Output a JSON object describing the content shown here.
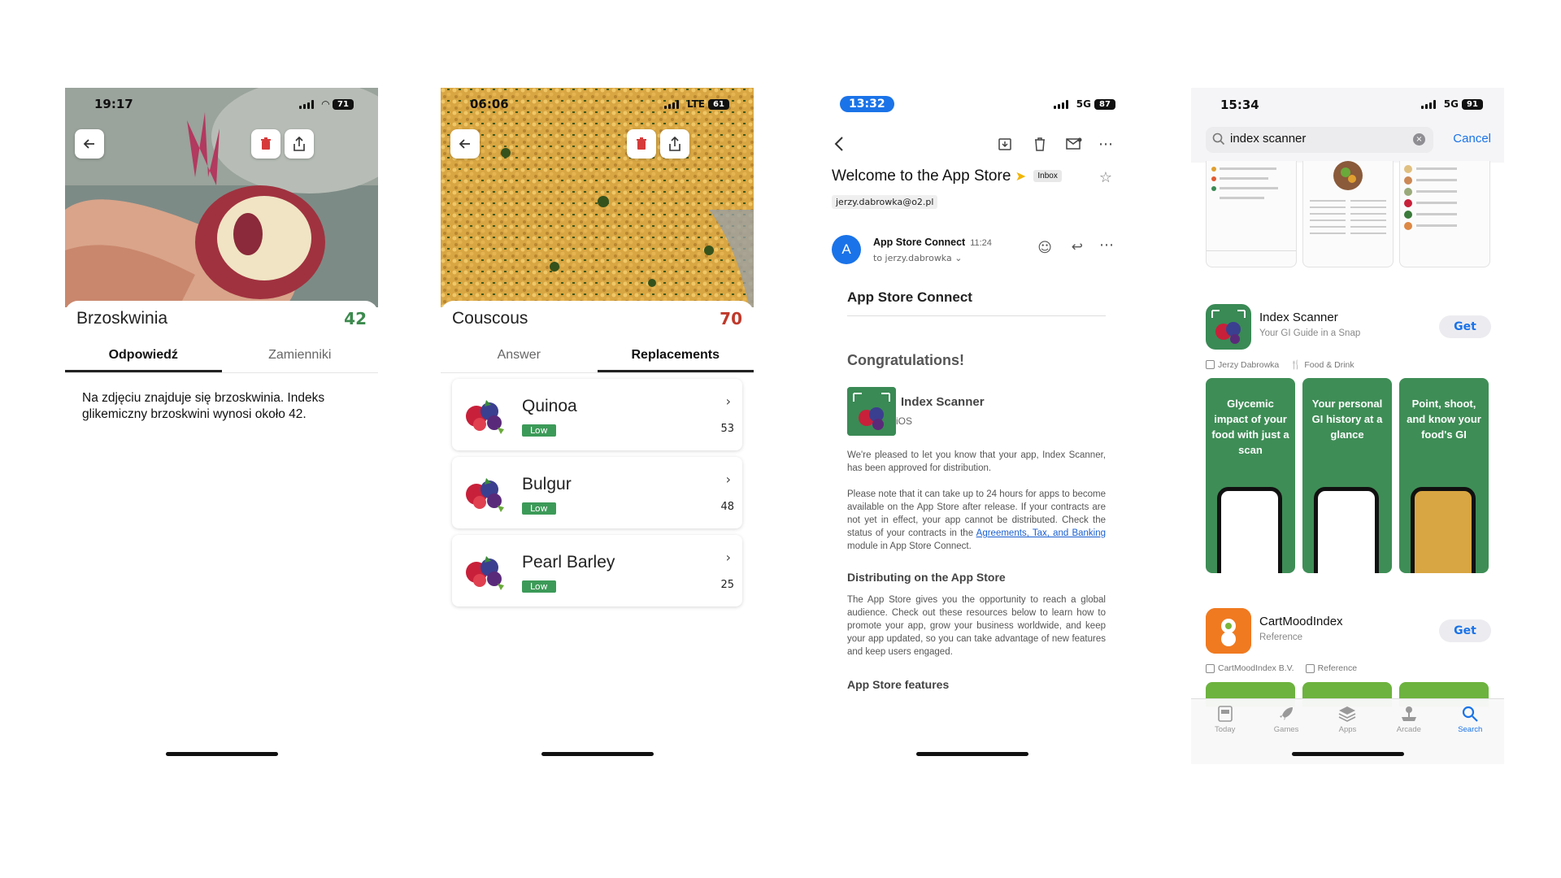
{
  "phone1": {
    "status": {
      "time": "19:17",
      "battery": "71"
    },
    "food_name": "Brzoskwinia",
    "gi_value": "42",
    "gi_color": "#3c8a4e",
    "tabs": [
      "Odpowiedź",
      "Zamienniki"
    ],
    "active_tab": "Odpowiedź",
    "answer": "Na zdjęciu znajduje się brzoskwinia. Indeks glikemiczny brzoskwini wynosi około 42.",
    "icons": {
      "back": "arrow-left-icon",
      "delete": "trash-icon",
      "share": "share-icon"
    }
  },
  "phone2": {
    "status": {
      "time": "06:06",
      "network": "LTE",
      "battery": "61"
    },
    "food_name": "Couscous",
    "gi_value": "70",
    "gi_color": "#c0392b",
    "tabs": [
      "Answer",
      "Replacements"
    ],
    "active_tab": "Replacements",
    "replacements": [
      {
        "name": "Quinoa",
        "badge": "Low",
        "gi": "53"
      },
      {
        "name": "Bulgur",
        "badge": "Low",
        "gi": "48"
      },
      {
        "name": "Pearl Barley",
        "badge": "Low",
        "gi": "25"
      }
    ],
    "badge_color": "#3c9a58"
  },
  "phone3": {
    "status": {
      "time": "13:32",
      "network": "5G",
      "battery": "87"
    },
    "subject": "Welcome to the App Store",
    "label_chip": "Inbox",
    "to_address": "jerzy.dabrowka@o2.pl",
    "sender": {
      "initial": "A",
      "name": "App Store Connect",
      "time": "11:24",
      "to": "to jerzy.dabrowka"
    },
    "body": {
      "heading": "App Store Connect",
      "congrats": "Congratulations!",
      "app_name": "Index Scanner",
      "platform": "iOS",
      "para1": "We're pleased to let you know that your app, Index Scanner, has been approved for distribution.",
      "para2a": "Please note that it can take up to 24 hours for apps to become available on the App Store after release.",
      "para2b": "If your contracts are not yet in effect, your app cannot be distributed. Check the status of your contracts in the",
      "link": "Agreements, Tax, and Banking",
      "para2c": "module in App Store Connect.",
      "section1": "Distributing on the App Store",
      "para3": "The App Store gives you the opportunity to reach a global audience. Check out these resources below to learn how to promote your app, grow your business worldwide, and keep your app updated, so you can take advantage of new features and keep users engaged.",
      "section2": "App Store features"
    },
    "accent": "#1a73e8"
  },
  "phone4": {
    "status": {
      "time": "15:34",
      "network": "5G",
      "battery": "91"
    },
    "search_query": "index scanner",
    "cancel": "Cancel",
    "app1": {
      "title": "Index Scanner",
      "subtitle": "Your GI Guide in a Snap",
      "get": "Get",
      "developer": "Jerzy Dabrowka",
      "category": "Food & Drink"
    },
    "promos": [
      "Glycemic impact of your food with just a scan",
      "Your personal GI history at a glance",
      "Point, shoot, and know your food's GI"
    ],
    "app2": {
      "title": "CartMoodIndex",
      "subtitle": "Reference",
      "get": "Get",
      "developer": "CartMoodIndex B.V.",
      "category": "Reference"
    },
    "tabbar": [
      {
        "label": "Today",
        "icon": "today-icon"
      },
      {
        "label": "Games",
        "icon": "rocket-icon"
      },
      {
        "label": "Apps",
        "icon": "layers-icon"
      },
      {
        "label": "Arcade",
        "icon": "joystick-icon"
      },
      {
        "label": "Search",
        "icon": "search-icon"
      }
    ],
    "active_tab": "Search",
    "accent": "#1a73e8",
    "promo_green": "#3e8d56"
  }
}
